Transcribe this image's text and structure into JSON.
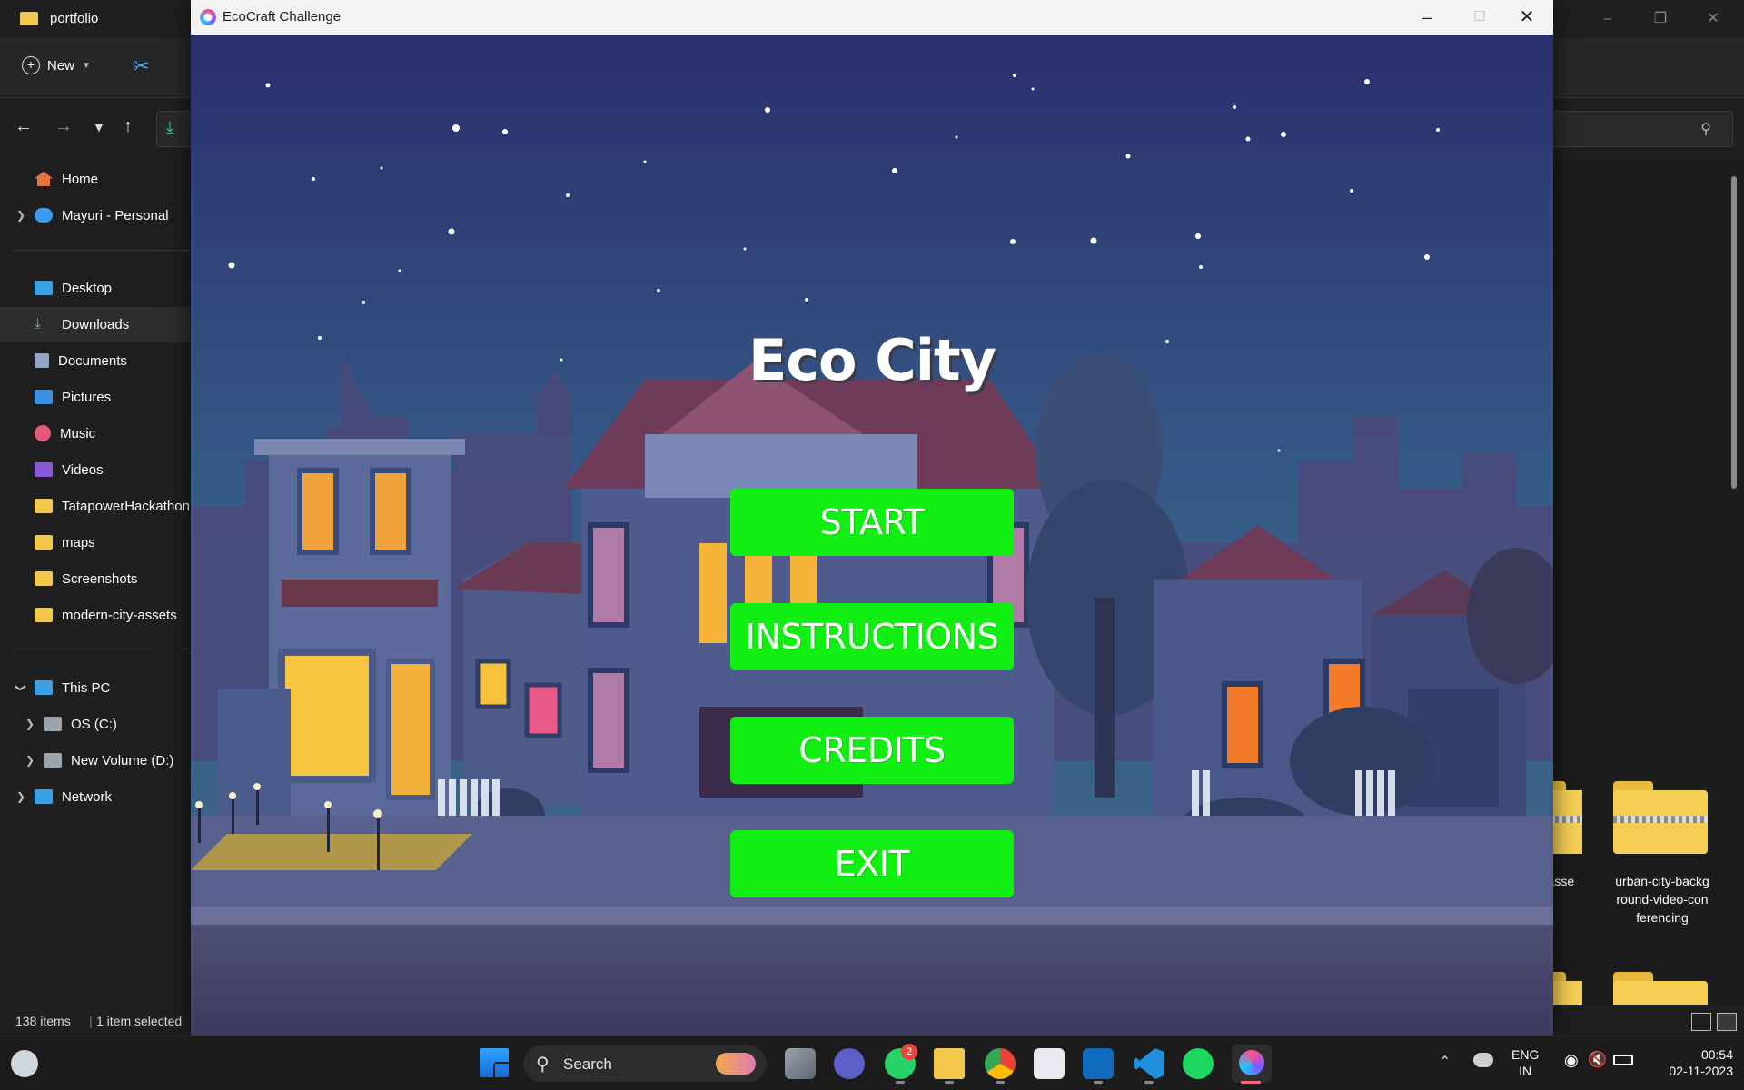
{
  "explorer": {
    "window_title": "portfolio",
    "toolbar": {
      "new_label": "New"
    },
    "sidebar": {
      "items": [
        {
          "label": "Home"
        },
        {
          "label": "Mayuri - Personal"
        },
        {
          "label": "Desktop"
        },
        {
          "label": "Downloads"
        },
        {
          "label": "Documents"
        },
        {
          "label": "Pictures"
        },
        {
          "label": "Music"
        },
        {
          "label": "Videos"
        },
        {
          "label": "TatapowerHackathon"
        },
        {
          "label": "maps"
        },
        {
          "label": "Screenshots"
        },
        {
          "label": "modern-city-assets"
        },
        {
          "label": "This PC"
        },
        {
          "label": "OS (C:)"
        },
        {
          "label": "New Volume (D:)"
        },
        {
          "label": "Network"
        }
      ]
    },
    "files": {
      "partial_label": "ty-asse",
      "file_label": "urban-city-backg round-video-con ferencing"
    },
    "status": {
      "item_count": "138 items",
      "selection": "1 item selected"
    }
  },
  "game": {
    "window_title": "EcoCraft Challenge",
    "title": "Eco City",
    "buttons": {
      "start": "START",
      "instructions": "INSTRUCTIONS",
      "credits": "CREDITS",
      "exit": "EXIT"
    },
    "colors": {
      "button": "#11ee11",
      "title": "#ffffff",
      "sky_top": "#2b2f6e",
      "sky_bottom": "#3f6a8c"
    }
  },
  "taskbar": {
    "search_label": "Search",
    "whatsapp_badge": "2",
    "tray": {
      "lang_line1": "ENG",
      "lang_line2": "IN",
      "time": "00:54",
      "date": "02-11-2023"
    }
  }
}
